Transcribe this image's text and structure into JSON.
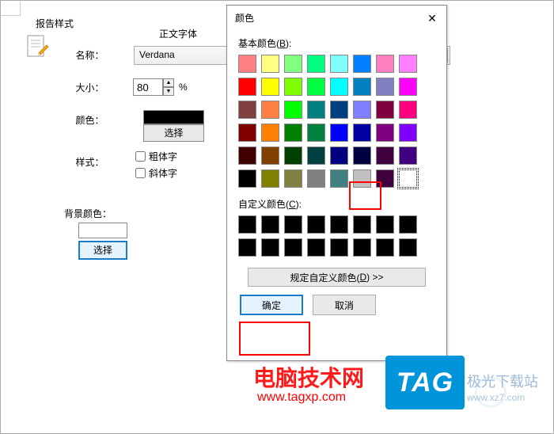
{
  "group_title": "报告样式",
  "section": "正文字体",
  "labels": {
    "name": "名称：",
    "size": "大小：",
    "color": "颜色：",
    "style": "样式：",
    "bg_color": "背景颜色："
  },
  "fields": {
    "font_name": "Verdana",
    "size_value": "80",
    "size_suffix": "%",
    "select_btn": "选择",
    "bold": "粗体字",
    "italic": "斜体字",
    "bg_select_btn": "选择"
  },
  "dialog": {
    "title": "颜色",
    "basic_label_prefix": "基本颜色(",
    "basic_label_key": "B",
    "basic_label_suffix": "):",
    "custom_label_prefix": "自定义颜色(",
    "custom_label_key": "C",
    "custom_label_suffix": "):",
    "define_prefix": "规定自定义颜色(",
    "define_key": "D",
    "define_suffix": ") >>",
    "ok": "确定",
    "cancel": "取消"
  },
  "basic_colors": [
    "#ff8080",
    "#ffff80",
    "#80ff80",
    "#00ff80",
    "#80ffff",
    "#0080ff",
    "#ff80c0",
    "#ff80ff",
    "#ff0000",
    "#ffff00",
    "#80ff00",
    "#00ff40",
    "#00ffff",
    "#0080c0",
    "#8080c0",
    "#ff00ff",
    "#804040",
    "#ff8040",
    "#00ff00",
    "#008080",
    "#004080",
    "#8080ff",
    "#800040",
    "#ff0080",
    "#800000",
    "#ff8000",
    "#008000",
    "#008040",
    "#0000ff",
    "#0000a0",
    "#800080",
    "#8000ff",
    "#400000",
    "#804000",
    "#004000",
    "#004040",
    "#000080",
    "#000040",
    "#400040",
    "#400080",
    "#000000",
    "#808000",
    "#808040",
    "#808080",
    "#408080",
    "#c0c0c0",
    "#400040",
    "#ffffff"
  ],
  "custom_colors": [
    "#000000",
    "#000000",
    "#000000",
    "#000000",
    "#000000",
    "#000000",
    "#000000",
    "#000000",
    "#000000",
    "#000000",
    "#000000",
    "#000000",
    "#000000",
    "#000000",
    "#000000",
    "#000000"
  ],
  "watermark": {
    "main": "电脑技术网",
    "sub": "www.tagxp.com",
    "tag": "TAG",
    "xz7": "极光下载站",
    "xz7_url": "www.xz7.com"
  }
}
